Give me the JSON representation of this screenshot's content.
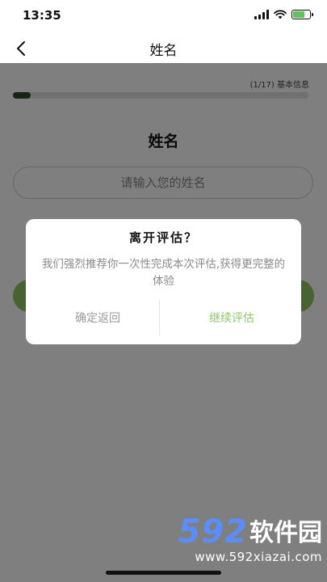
{
  "status_bar": {
    "time": "13:35",
    "icons": [
      "signal-icon",
      "wifi-icon",
      "battery-charging-icon"
    ]
  },
  "nav": {
    "title": "姓名",
    "back_icon": "chevron-left-icon"
  },
  "progress": {
    "label": "(1/17) 基本信息",
    "current": 1,
    "total": 17,
    "fraction": 0.06
  },
  "form": {
    "field_title": "姓名",
    "name_placeholder": "请输入您的姓名",
    "name_value": ""
  },
  "dialog": {
    "title": "离开评估？",
    "message": "我们强烈推荐你一次性完成本次评估,获得更完整的体验",
    "leave_label": "确定返回",
    "continue_label": "继续评估"
  },
  "watermark": {
    "number": "592",
    "name": "软件园",
    "url": "www.592xiazai.com"
  },
  "colors": {
    "accent": "#8fc764",
    "progress_fill": "#2f4a2c",
    "overlay": "rgba(0,0,0,0.5)",
    "watermark_blue": "#5a8dff"
  }
}
